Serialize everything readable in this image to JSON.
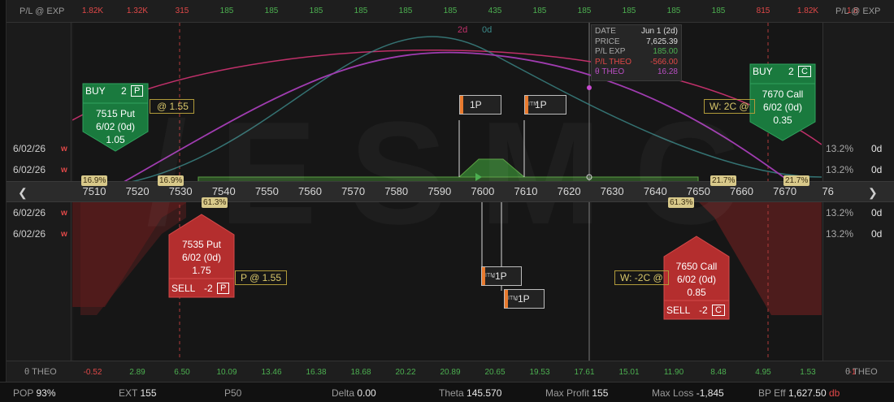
{
  "pl_exp": {
    "label": "P/L @ EXP",
    "values": [
      {
        "text": "1.82K",
        "tone": "neg"
      },
      {
        "text": "1.32K",
        "tone": "neg"
      },
      {
        "text": "315",
        "tone": "neg"
      },
      {
        "text": "185",
        "tone": "pos"
      },
      {
        "text": "185",
        "tone": "pos"
      },
      {
        "text": "185",
        "tone": "pos"
      },
      {
        "text": "185",
        "tone": "pos"
      },
      {
        "text": "185",
        "tone": "pos"
      },
      {
        "text": "185",
        "tone": "pos"
      },
      {
        "text": "435",
        "tone": "pos"
      },
      {
        "text": "185",
        "tone": "pos"
      },
      {
        "text": "185",
        "tone": "pos"
      },
      {
        "text": "185",
        "tone": "pos"
      },
      {
        "text": "185",
        "tone": "pos"
      },
      {
        "text": "185",
        "tone": "pos"
      },
      {
        "text": "815",
        "tone": "neg"
      },
      {
        "text": "1.82K",
        "tone": "neg"
      },
      {
        "text": "1.8",
        "tone": "neg"
      }
    ]
  },
  "theta": {
    "label": "θ THEO",
    "values": [
      {
        "text": "-0.52",
        "tone": "neg"
      },
      {
        "text": "2.89",
        "tone": "pos"
      },
      {
        "text": "6.50",
        "tone": "pos"
      },
      {
        "text": "10.09",
        "tone": "pos"
      },
      {
        "text": "13.46",
        "tone": "pos"
      },
      {
        "text": "16.38",
        "tone": "pos"
      },
      {
        "text": "18.68",
        "tone": "pos"
      },
      {
        "text": "20.22",
        "tone": "pos"
      },
      {
        "text": "20.89",
        "tone": "pos"
      },
      {
        "text": "20.65",
        "tone": "pos"
      },
      {
        "text": "19.53",
        "tone": "pos"
      },
      {
        "text": "17.61",
        "tone": "pos"
      },
      {
        "text": "15.01",
        "tone": "pos"
      },
      {
        "text": "11.90",
        "tone": "pos"
      },
      {
        "text": "8.48",
        "tone": "pos"
      },
      {
        "text": "4.95",
        "tone": "pos"
      },
      {
        "text": "1.53",
        "tone": "pos"
      },
      {
        "text": "-1",
        "tone": "neg"
      }
    ]
  },
  "axis": {
    "ticks": [
      "7510",
      "7520",
      "7530",
      "7540",
      "7550",
      "7560",
      "7570",
      "7580",
      "7590",
      "7600",
      "7610",
      "7620",
      "7630",
      "7640",
      "7650",
      "7660",
      "7670",
      "76"
    ],
    "left_arrow": "❮",
    "right_arrow": "❯"
  },
  "expiries": {
    "upper": [
      {
        "date": "6/02/26",
        "tag": "w",
        "iv": "13.2%",
        "dte": "0d"
      },
      {
        "date": "6/02/26",
        "tag": "w",
        "iv": "13.2%",
        "dte": "0d"
      }
    ],
    "lower": [
      {
        "date": "6/02/26",
        "tag": "w",
        "iv": "13.2%",
        "dte": "0d"
      },
      {
        "date": "6/02/26",
        "tag": "w",
        "iv": "13.2%",
        "dte": "0d"
      }
    ]
  },
  "legend": {
    "d2": "2d",
    "d0": "0d"
  },
  "info": {
    "date_k": "DATE",
    "date_v": "Jun 1 (2d)",
    "price_k": "PRICE",
    "price_v": "7,625.39",
    "plexp_k": "P/L EXP",
    "plexp_v": "185.00",
    "pltheo_k": "P/L THEO",
    "pltheo_v": "-566.00",
    "theta_k": "θ THEO",
    "theta_v": "16.28"
  },
  "cards": {
    "buy_put": {
      "side": "BUY",
      "qty": "2",
      "type": "P",
      "line1": "7515 Put",
      "line2": "6/02 (0d)",
      "line3": "1.05"
    },
    "sell_put": {
      "side": "SELL",
      "qty": "-2",
      "type": "P",
      "line1": "7535 Put",
      "line2": "6/02 (0d)",
      "line3": "1.75"
    },
    "buy_call": {
      "side": "BUY",
      "qty": "2",
      "type": "C",
      "line1": "7670 Call",
      "line2": "6/02 (0d)",
      "line3": "0.35"
    },
    "sell_call": {
      "side": "SELL",
      "qty": "-2",
      "type": "C",
      "line1": "7650 Call",
      "line2": "6/02 (0d)",
      "line3": "0.85"
    }
  },
  "wings": {
    "put_upper": "@ 1.55",
    "put_lower": "P @ 1.55",
    "call_upper": "W: 2C @",
    "call_lower": "W: -2C @"
  },
  "pct": {
    "p1": "16.9%",
    "p2": "16.9%",
    "p3": "61.3%",
    "c1": "21.7%",
    "c2": "21.7%",
    "c3": "61.3%"
  },
  "flags": {
    "f1": {
      "text": "1P",
      "itm": ""
    },
    "f2": {
      "text": "1P",
      "itm": "ITM"
    },
    "f3": {
      "text": "-1P",
      "itm": "ITM"
    },
    "f4": {
      "text": "-1P",
      "itm": "ITM"
    }
  },
  "watermark": "/ESMC",
  "stats": {
    "pop_k": "POP",
    "pop_v": "93%",
    "ext_k": "EXT",
    "ext_v": "155",
    "p50_k": "P50",
    "p50_v": "",
    "delta_k": "Delta",
    "delta_v": "0.00",
    "theta_k": "Theta",
    "theta_v": "145.570",
    "maxp_k": "Max Profit",
    "maxp_v": "155",
    "maxl_k": "Max Loss",
    "maxl_v": "-1,845",
    "bp_k": "BP Eff",
    "bp_v": "1,627.50",
    "bp_unit": "db"
  },
  "colors": {
    "profit_fill": "#2c5a22",
    "loss_fill": "#5a1c1c",
    "accent_green": "#4caf50",
    "accent_red": "#e04848",
    "curve_2d": "#c0306a",
    "curve_0d": "#3c8a8a",
    "curve_theta": "#a03cb0"
  }
}
